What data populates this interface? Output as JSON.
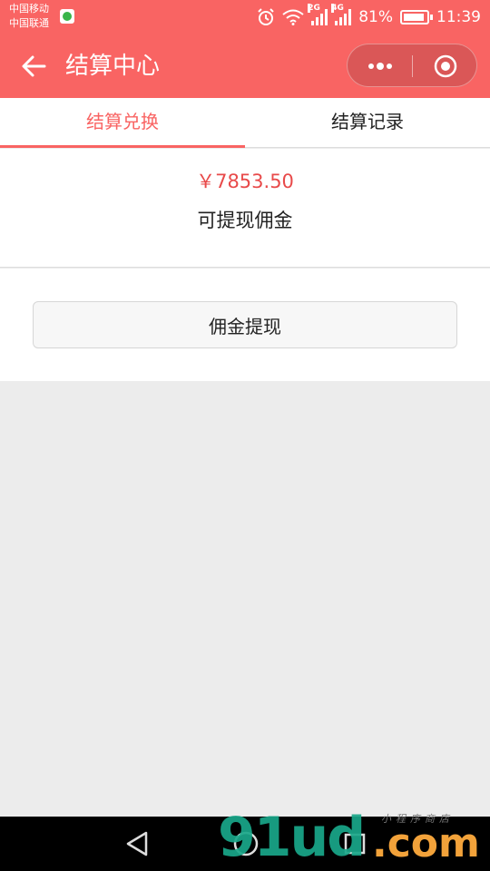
{
  "status_bar": {
    "carrier_1": "中国移动",
    "carrier_2": "中国联通",
    "network_1": "2G",
    "network_2": "4G",
    "battery": "81%",
    "time": "11:39"
  },
  "navbar": {
    "title": "结算中心",
    "color": "#f96463"
  },
  "tabs": [
    {
      "label": "结算兑换",
      "active": true
    },
    {
      "label": "结算记录",
      "active": false
    }
  ],
  "summary": {
    "amount": "￥7853.50",
    "amount_label": "可提现佣金",
    "amount_color": "#e84a4a"
  },
  "action": {
    "withdraw_label": "佣金提现"
  },
  "watermark": {
    "main": "91ud",
    "domain": ".com",
    "sub": "小程序商店"
  }
}
